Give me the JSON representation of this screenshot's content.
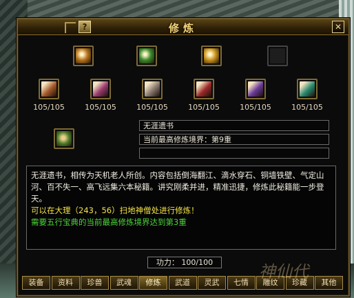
{
  "window": {
    "title": "修炼",
    "help_label": "?",
    "close_label": "✕"
  },
  "books": [
    {
      "icon": "book-scroll-icon",
      "color": "#b8741e"
    },
    {
      "icon": "jade-book-icon",
      "color": "#3d8a2c"
    },
    {
      "icon": "golden-tome-icon",
      "color": "#c9921f"
    },
    {
      "icon": "empty-slot-icon",
      "color": "#222222"
    }
  ],
  "skills": [
    {
      "icon": "skill-scroll-orange-icon",
      "color": "#a4582a",
      "count": "105/105"
    },
    {
      "icon": "skill-scroll-pink-icon",
      "color": "#9a3c6e",
      "count": "105/105"
    },
    {
      "icon": "skill-scroll-grey-icon",
      "color": "#8a7a70",
      "count": "105/105"
    },
    {
      "icon": "skill-scroll-red-icon",
      "color": "#9c2a2a",
      "count": "105/105"
    },
    {
      "icon": "skill-scroll-purple-icon",
      "color": "#6a3a9a",
      "count": "105/105"
    },
    {
      "icon": "skill-scroll-teal-icon",
      "color": "#2a8a70",
      "count": "105/105"
    }
  ],
  "selected": {
    "icon": "wuya-book-icon",
    "name": "无涯遗书",
    "level": "当前最高修炼境界：第9重",
    "extra": ""
  },
  "description": {
    "line1": "无涯遗书，相传为天机老人所创。内容包括倒海翻江、滴水穿石、铜墙铁壁、气定山河、百不失一、高飞远集六本秘籍。讲究刚柔并进，精准迅捷，修炼此秘籍能一步登天。",
    "line2": "可以在大理（243，56）扫地神僧处进行修炼！",
    "line3": "需要五行宝典的当前最高修炼境界达到第3重"
  },
  "power": {
    "label": "功力：",
    "value": "100/100"
  },
  "tabs": [
    "装备",
    "资料",
    "珍兽",
    "武魂",
    "修炼",
    "武道",
    "灵武",
    "七情",
    "雕纹",
    "珍藏",
    "其他"
  ],
  "active_tab": "修炼",
  "watermark": "神仙代"
}
